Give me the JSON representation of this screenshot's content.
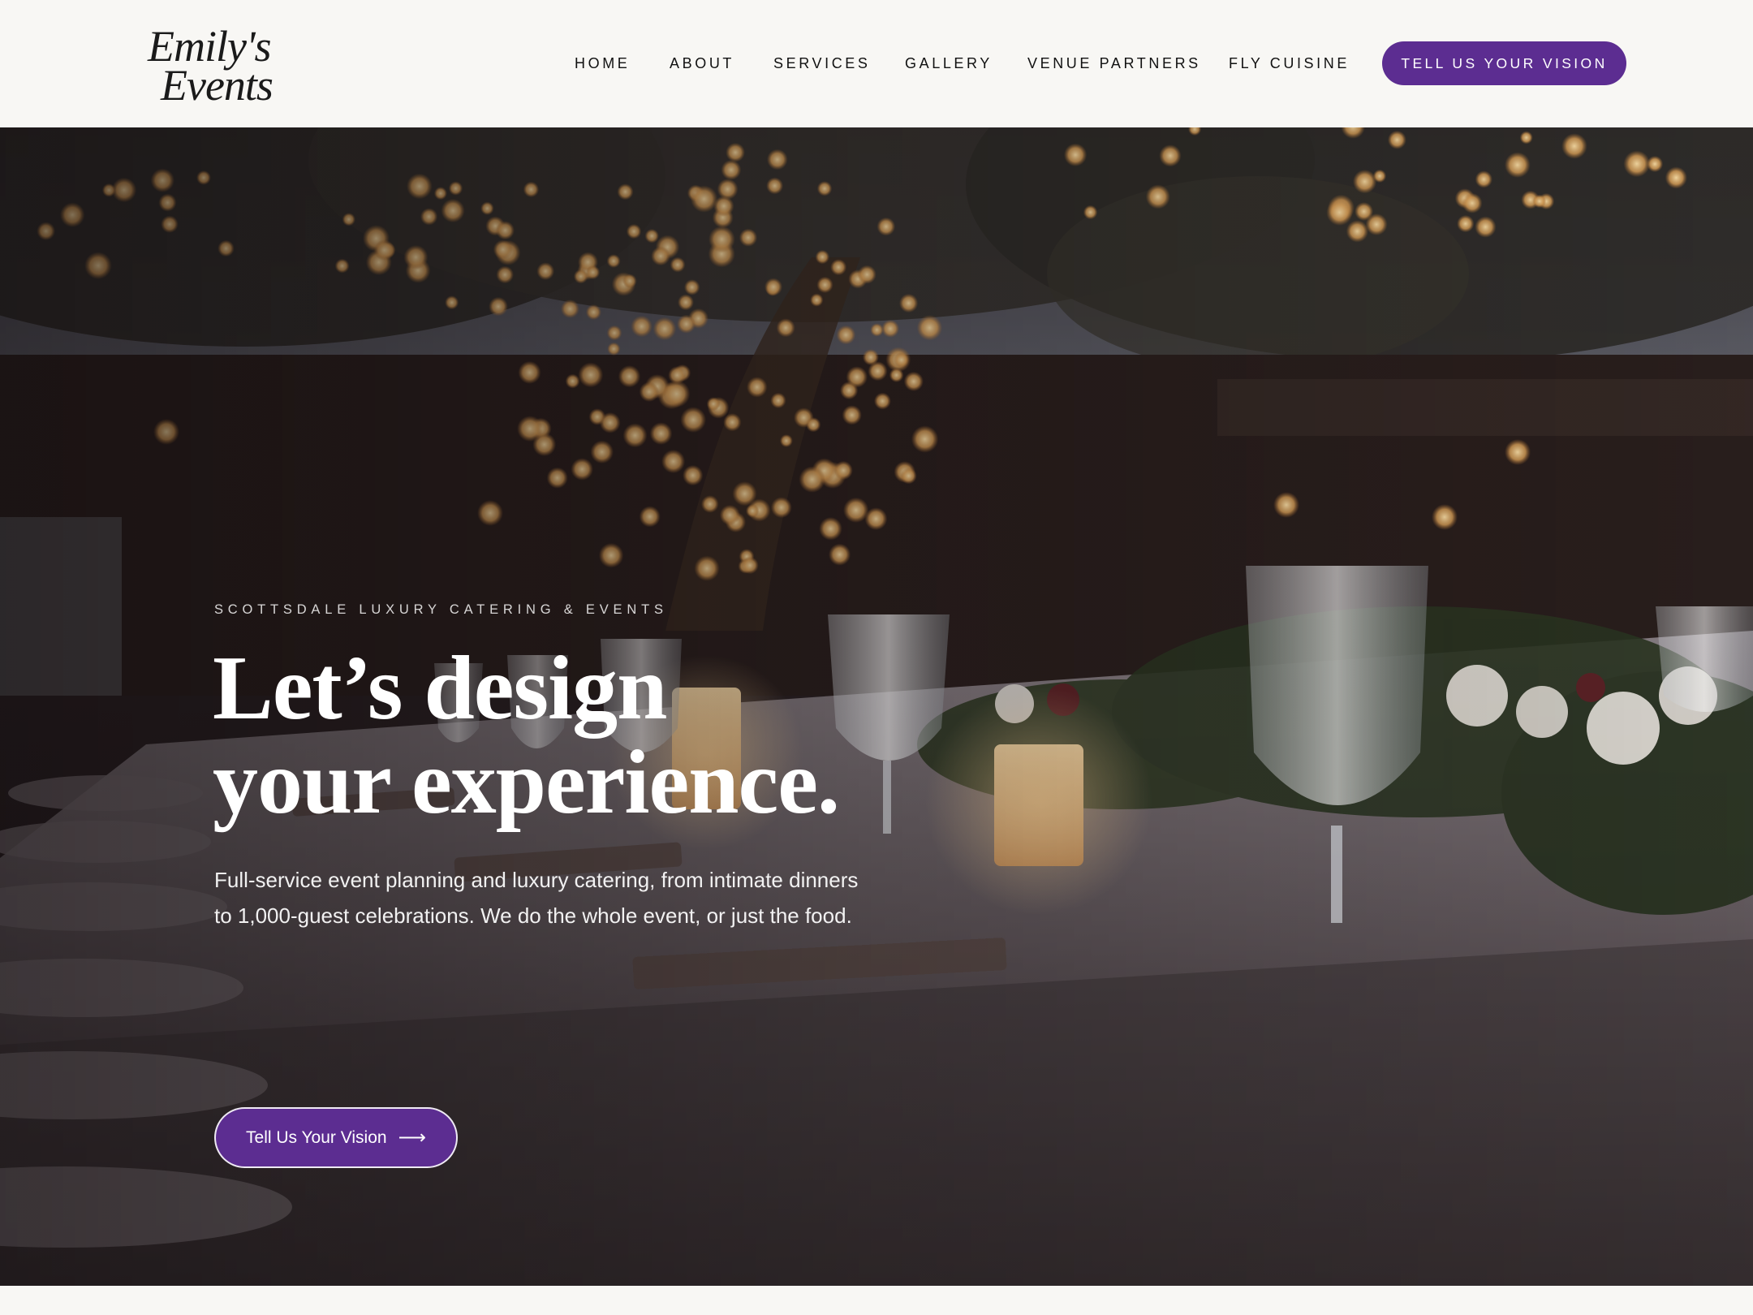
{
  "brand": {
    "logo_line1": "Emily's",
    "logo_line2": "Events",
    "accent_color": "#5c2d91"
  },
  "nav": {
    "items": [
      {
        "label": "HOME"
      },
      {
        "label": "ABOUT"
      },
      {
        "label": "SERVICES"
      },
      {
        "label": "GALLERY"
      },
      {
        "label": "VENUE PARTNERS"
      },
      {
        "label": "FLY CUISINE"
      }
    ],
    "cta_label": "TELL US YOUR VISION"
  },
  "hero": {
    "eyebrow": "SCOTTSDALE LUXURY CATERING & EVENTS",
    "headline_line1": "Let’s design",
    "headline_line2": "your experience.",
    "subcopy_line1": "Full-service event planning and luxury catering, from intimate dinners",
    "subcopy_line2": "to 1,000-guest celebrations. We do the whole event, or just the food.",
    "cta_label": "Tell Us Your Vision",
    "cta_icon": "arrow-right-icon",
    "cta_glyph": "⟶",
    "background_description_icon": "outdoor-dinner-table-photo"
  }
}
